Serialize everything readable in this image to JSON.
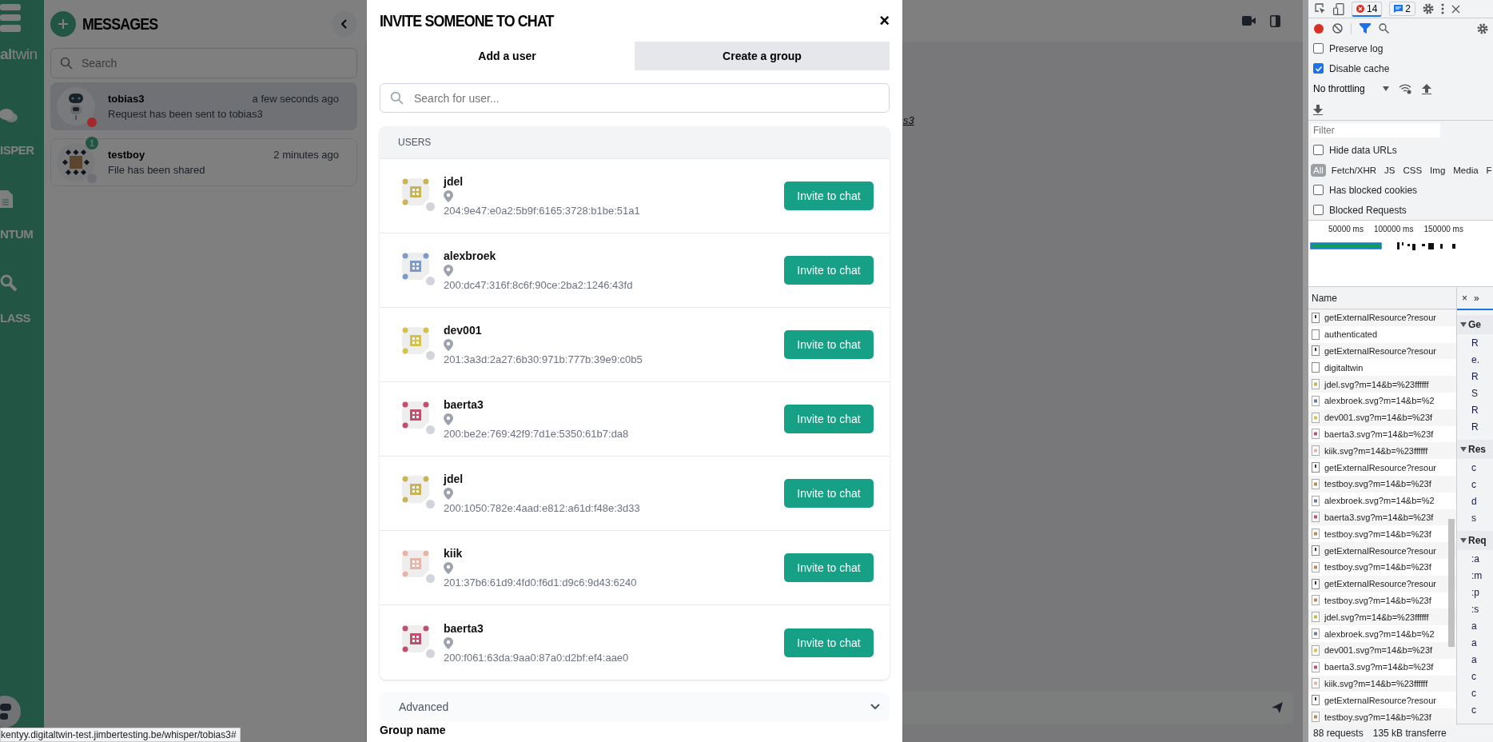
{
  "rail": {
    "logo": "**al**twin",
    "items": [
      {
        "kind": "chat",
        "label": "ISPER"
      },
      {
        "kind": "doc",
        "label": "NTUM"
      },
      {
        "kind": "search",
        "label": "LASS"
      }
    ]
  },
  "messages": {
    "title": "MESSAGES",
    "search_placeholder": "Search",
    "conversations": [
      {
        "name": "tobias3",
        "time": "a few seconds ago",
        "preview": "Request has been sent to tobias3",
        "selected": true,
        "robot_avatar": true,
        "color": "#a3282c"
      },
      {
        "name": "testboy",
        "time": "2 minutes ago",
        "preview": "File has been shared",
        "selected": false,
        "robot_avatar": false,
        "color": "#6e7075",
        "unread": "1"
      }
    ]
  },
  "chat": {
    "link_fragment": "s3"
  },
  "modal": {
    "title": "INVITE SOMEONE TO CHAT",
    "close": "×",
    "tabs": [
      {
        "label": "Add a user",
        "selected": true
      },
      {
        "label": "Create a group",
        "selected": false
      }
    ],
    "search_placeholder": "Search for user...",
    "users_heading": "USERS",
    "users": [
      {
        "name": "jdel",
        "address": "204:9e47:e0a2:5b9f:6165:3728:b1be:51a1",
        "color": "#c9b458",
        "button": "Invite to chat"
      },
      {
        "name": "alexbroek",
        "address": "200:dc47:316f:8c6f:90ce:2ba2:1246:43fd",
        "color": "#7a9cc6",
        "button": "Invite to chat"
      },
      {
        "name": "dev001",
        "address": "201:3a3d:2a27:6b30:971b:777b:39e9:c0b5",
        "color": "#d4c24a",
        "button": "Invite to chat"
      },
      {
        "name": "baerta3",
        "address": "200:be2e:769:42f9:7d1e:5350:61b7:da8",
        "color": "#c0506e",
        "button": "Invite to chat"
      },
      {
        "name": "jdel",
        "address": "200:1050:782e:4aad:e812:a61d:f48e:3d33",
        "color": "#c9b458",
        "button": "Invite to chat"
      },
      {
        "name": "kiik",
        "address": "201:37b6:61d9:4fd0:f6d1:d9c6:9d43:6240",
        "color": "#e8b4a8",
        "button": "Invite to chat"
      },
      {
        "name": "baerta3",
        "address": "200:f061:63da:9aa0:87a0:d2bf:ef4:aae0",
        "color": "#c0506e",
        "button": "Invite to chat"
      }
    ],
    "advanced": "Advanced",
    "group_name_label": "Group name"
  },
  "status_url": "kentyy.digitaltwin-test.jimbertesting.be/whisper/tobias3#",
  "devtools": {
    "errors": "14",
    "messages": "2",
    "checks": [
      {
        "label": "Preserve log",
        "checked": false
      },
      {
        "label": "Disable cache",
        "checked": true
      }
    ],
    "throttling": "No throttling",
    "filter_placeholder": "Filter",
    "hide_data_urls": {
      "label": "Hide data URLs",
      "checked": false
    },
    "type_filters": [
      {
        "label": "All",
        "selected": true
      },
      {
        "label": "Fetch/XHR",
        "selected": false
      },
      {
        "label": "JS",
        "selected": false
      },
      {
        "label": "CSS",
        "selected": false
      },
      {
        "label": "Img",
        "selected": false
      },
      {
        "label": "Media",
        "selected": false
      },
      {
        "label": "F",
        "selected": false
      }
    ],
    "blocked": [
      {
        "label": "Has blocked cookies",
        "checked": false
      },
      {
        "label": "Blocked Requests",
        "checked": false
      }
    ],
    "timeline_ticks": [
      "50000 ms",
      "100000 ms",
      "150000 ms"
    ],
    "name_header": "Name",
    "detail_tabs": [
      "×",
      "»"
    ],
    "requests": [
      {
        "name": "getExternalResource?resour",
        "kind": "script"
      },
      {
        "name": "authenticated",
        "kind": "blank"
      },
      {
        "name": "getExternalResource?resour",
        "kind": "script"
      },
      {
        "name": "digitaltwin",
        "kind": "blank"
      },
      {
        "name": "jdel.svg?m=14&b=%23ffffff",
        "kind": "image",
        "color": "#c9b458"
      },
      {
        "name": "alexbroek.svg?m=14&b=%2",
        "kind": "image",
        "color": "#6b7b9b"
      },
      {
        "name": "dev001.svg?m=14&b=%23f",
        "kind": "image",
        "color": "#d4c24a"
      },
      {
        "name": "baerta3.svg?m=14&b=%23f",
        "kind": "image",
        "color": "#c0506e"
      },
      {
        "name": "kiik.svg?m=14&b=%23ffffff",
        "kind": "image",
        "color": "#e8b4a8"
      },
      {
        "name": "getExternalResource?resour",
        "kind": "script"
      },
      {
        "name": "testboy.svg?m=14&b=%23f",
        "kind": "image",
        "color": "#b88a5a"
      },
      {
        "name": "alexbroek.svg?m=14&b=%2",
        "kind": "image",
        "color": "#6b7b9b"
      },
      {
        "name": "baerta3.svg?m=14&b=%23f",
        "kind": "image",
        "color": "#c0506e"
      },
      {
        "name": "testboy.svg?m=14&b=%23f",
        "kind": "image",
        "color": "#b88a5a"
      },
      {
        "name": "getExternalResource?resour",
        "kind": "script"
      },
      {
        "name": "testboy.svg?m=14&b=%23f",
        "kind": "image",
        "color": "#b88a5a"
      },
      {
        "name": "getExternalResource?resour",
        "kind": "script"
      },
      {
        "name": "testboy.svg?m=14&b=%23f",
        "kind": "image",
        "color": "#b88a5a"
      },
      {
        "name": "jdel.svg?m=14&b=%23ffffff",
        "kind": "image",
        "color": "#c9b458"
      },
      {
        "name": "alexbroek.svg?m=14&b=%2",
        "kind": "image",
        "color": "#6b7b9b"
      },
      {
        "name": "dev001.svg?m=14&b=%23f",
        "kind": "image",
        "color": "#d4c24a"
      },
      {
        "name": "baerta3.svg?m=14&b=%23f",
        "kind": "image",
        "color": "#c0506e"
      },
      {
        "name": "kiik.svg?m=14&b=%23ffffff",
        "kind": "image",
        "color": "#e8b4a8"
      },
      {
        "name": "getExternalResource?resour",
        "kind": "script"
      },
      {
        "name": "testboy.svg?m=14&b=%23f",
        "kind": "image",
        "color": "#b88a5a"
      }
    ],
    "detail_sections": [
      {
        "title": "Ge",
        "items": [
          "R",
          "e.",
          "R",
          "S",
          "R",
          "R"
        ]
      },
      {
        "title": "Res",
        "items": [
          "c",
          "c",
          "d",
          "s"
        ]
      },
      {
        "title": "Req",
        "items": [
          ":a",
          ":m",
          ":p",
          ":s",
          "a",
          "a",
          "a",
          "c",
          "c",
          "c"
        ]
      }
    ],
    "footer": [
      "88 requests",
      "135 kB transferre"
    ]
  }
}
